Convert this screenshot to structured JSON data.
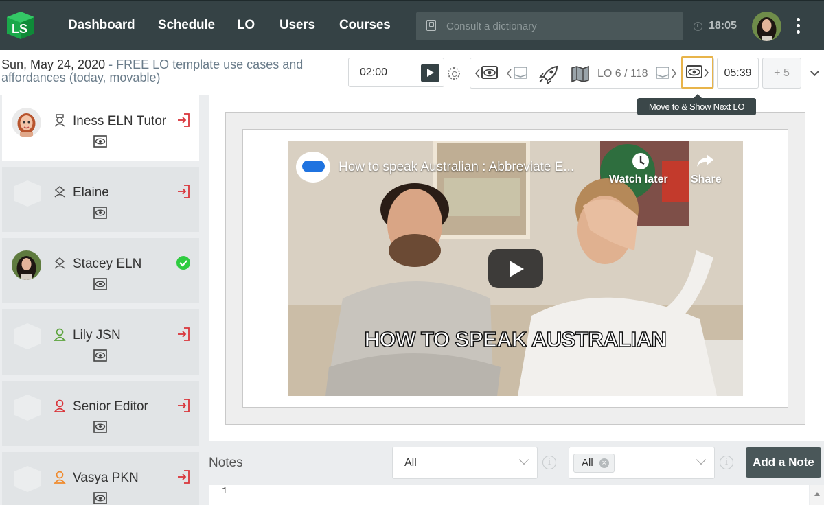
{
  "nav": {
    "items": [
      "Dashboard",
      "Schedule",
      "LO",
      "Users",
      "Courses"
    ],
    "search_placeholder": "Consult a dictionary",
    "time": "18:05"
  },
  "subheader": {
    "date": "Sun, May 24, 2020",
    "title": " - FREE LO template use cases and affordances (today, movable)",
    "timer": "02:00",
    "lo_counter": "LO 6 / 118",
    "elapsed": "05:39",
    "extra": "+ 5",
    "tooltip": "Move to & Show Next LO"
  },
  "participants": [
    {
      "name": "Iness ELN Tutor",
      "role_icon": "tutor-icon",
      "role_color": "#555555",
      "status": "exit",
      "active": true,
      "has_photo": true
    },
    {
      "name": "Elaine",
      "role_icon": "student-icon",
      "role_color": "#555555",
      "status": "exit",
      "active": false,
      "has_photo": false
    },
    {
      "name": "Stacey ELN",
      "role_icon": "student-icon",
      "role_color": "#555555",
      "status": "online",
      "active": false,
      "has_photo": true
    },
    {
      "name": "Lily JSN",
      "role_icon": "user-icon",
      "role_color": "#5aa23a",
      "status": "exit",
      "active": false,
      "has_photo": false
    },
    {
      "name": "Senior Editor",
      "role_icon": "user-icon",
      "role_color": "#d9343a",
      "status": "exit",
      "active": false,
      "has_photo": false
    },
    {
      "name": "Vasya PKN",
      "role_icon": "user-icon",
      "role_color": "#f08a2c",
      "status": "exit",
      "active": false,
      "has_photo": false
    }
  ],
  "video": {
    "title": "How to speak Australian : Abbreviate E...",
    "watch_later": "Watch later",
    "share": "Share",
    "caption": "HOW TO SPEAK AUSTRALIAN"
  },
  "notes": {
    "label": "Notes",
    "filter1": "All",
    "filter2_tag": "All",
    "add_button": "Add a Note",
    "line_number": "1"
  },
  "colors": {
    "nav_bg": "#354245",
    "accent_green": "#2ecc40",
    "exit_red": "#d9343a",
    "next_highlight": "#e8b44a"
  }
}
